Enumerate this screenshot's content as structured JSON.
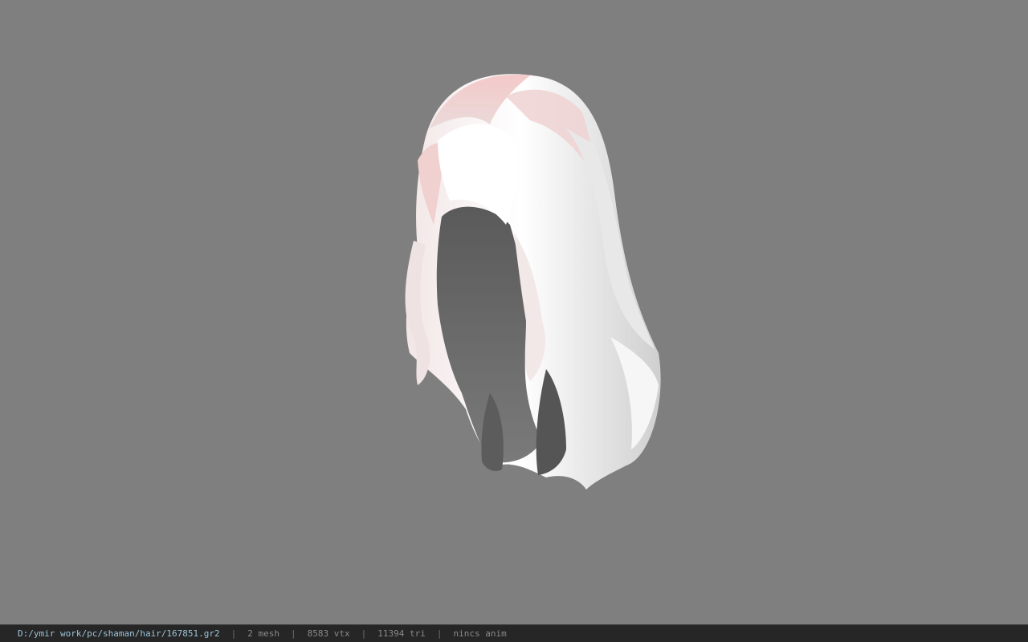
{
  "viewport": {
    "background": "#7f7f7f",
    "model_icon": "hair-mesh"
  },
  "status": {
    "path": "D:/ymir work/pc/shaman/hair/167851.gr2",
    "separator": "|",
    "mesh": "2 mesh",
    "vertices": "8583 vtx",
    "triangles": "11394 tri",
    "anim": "nincs anim"
  }
}
